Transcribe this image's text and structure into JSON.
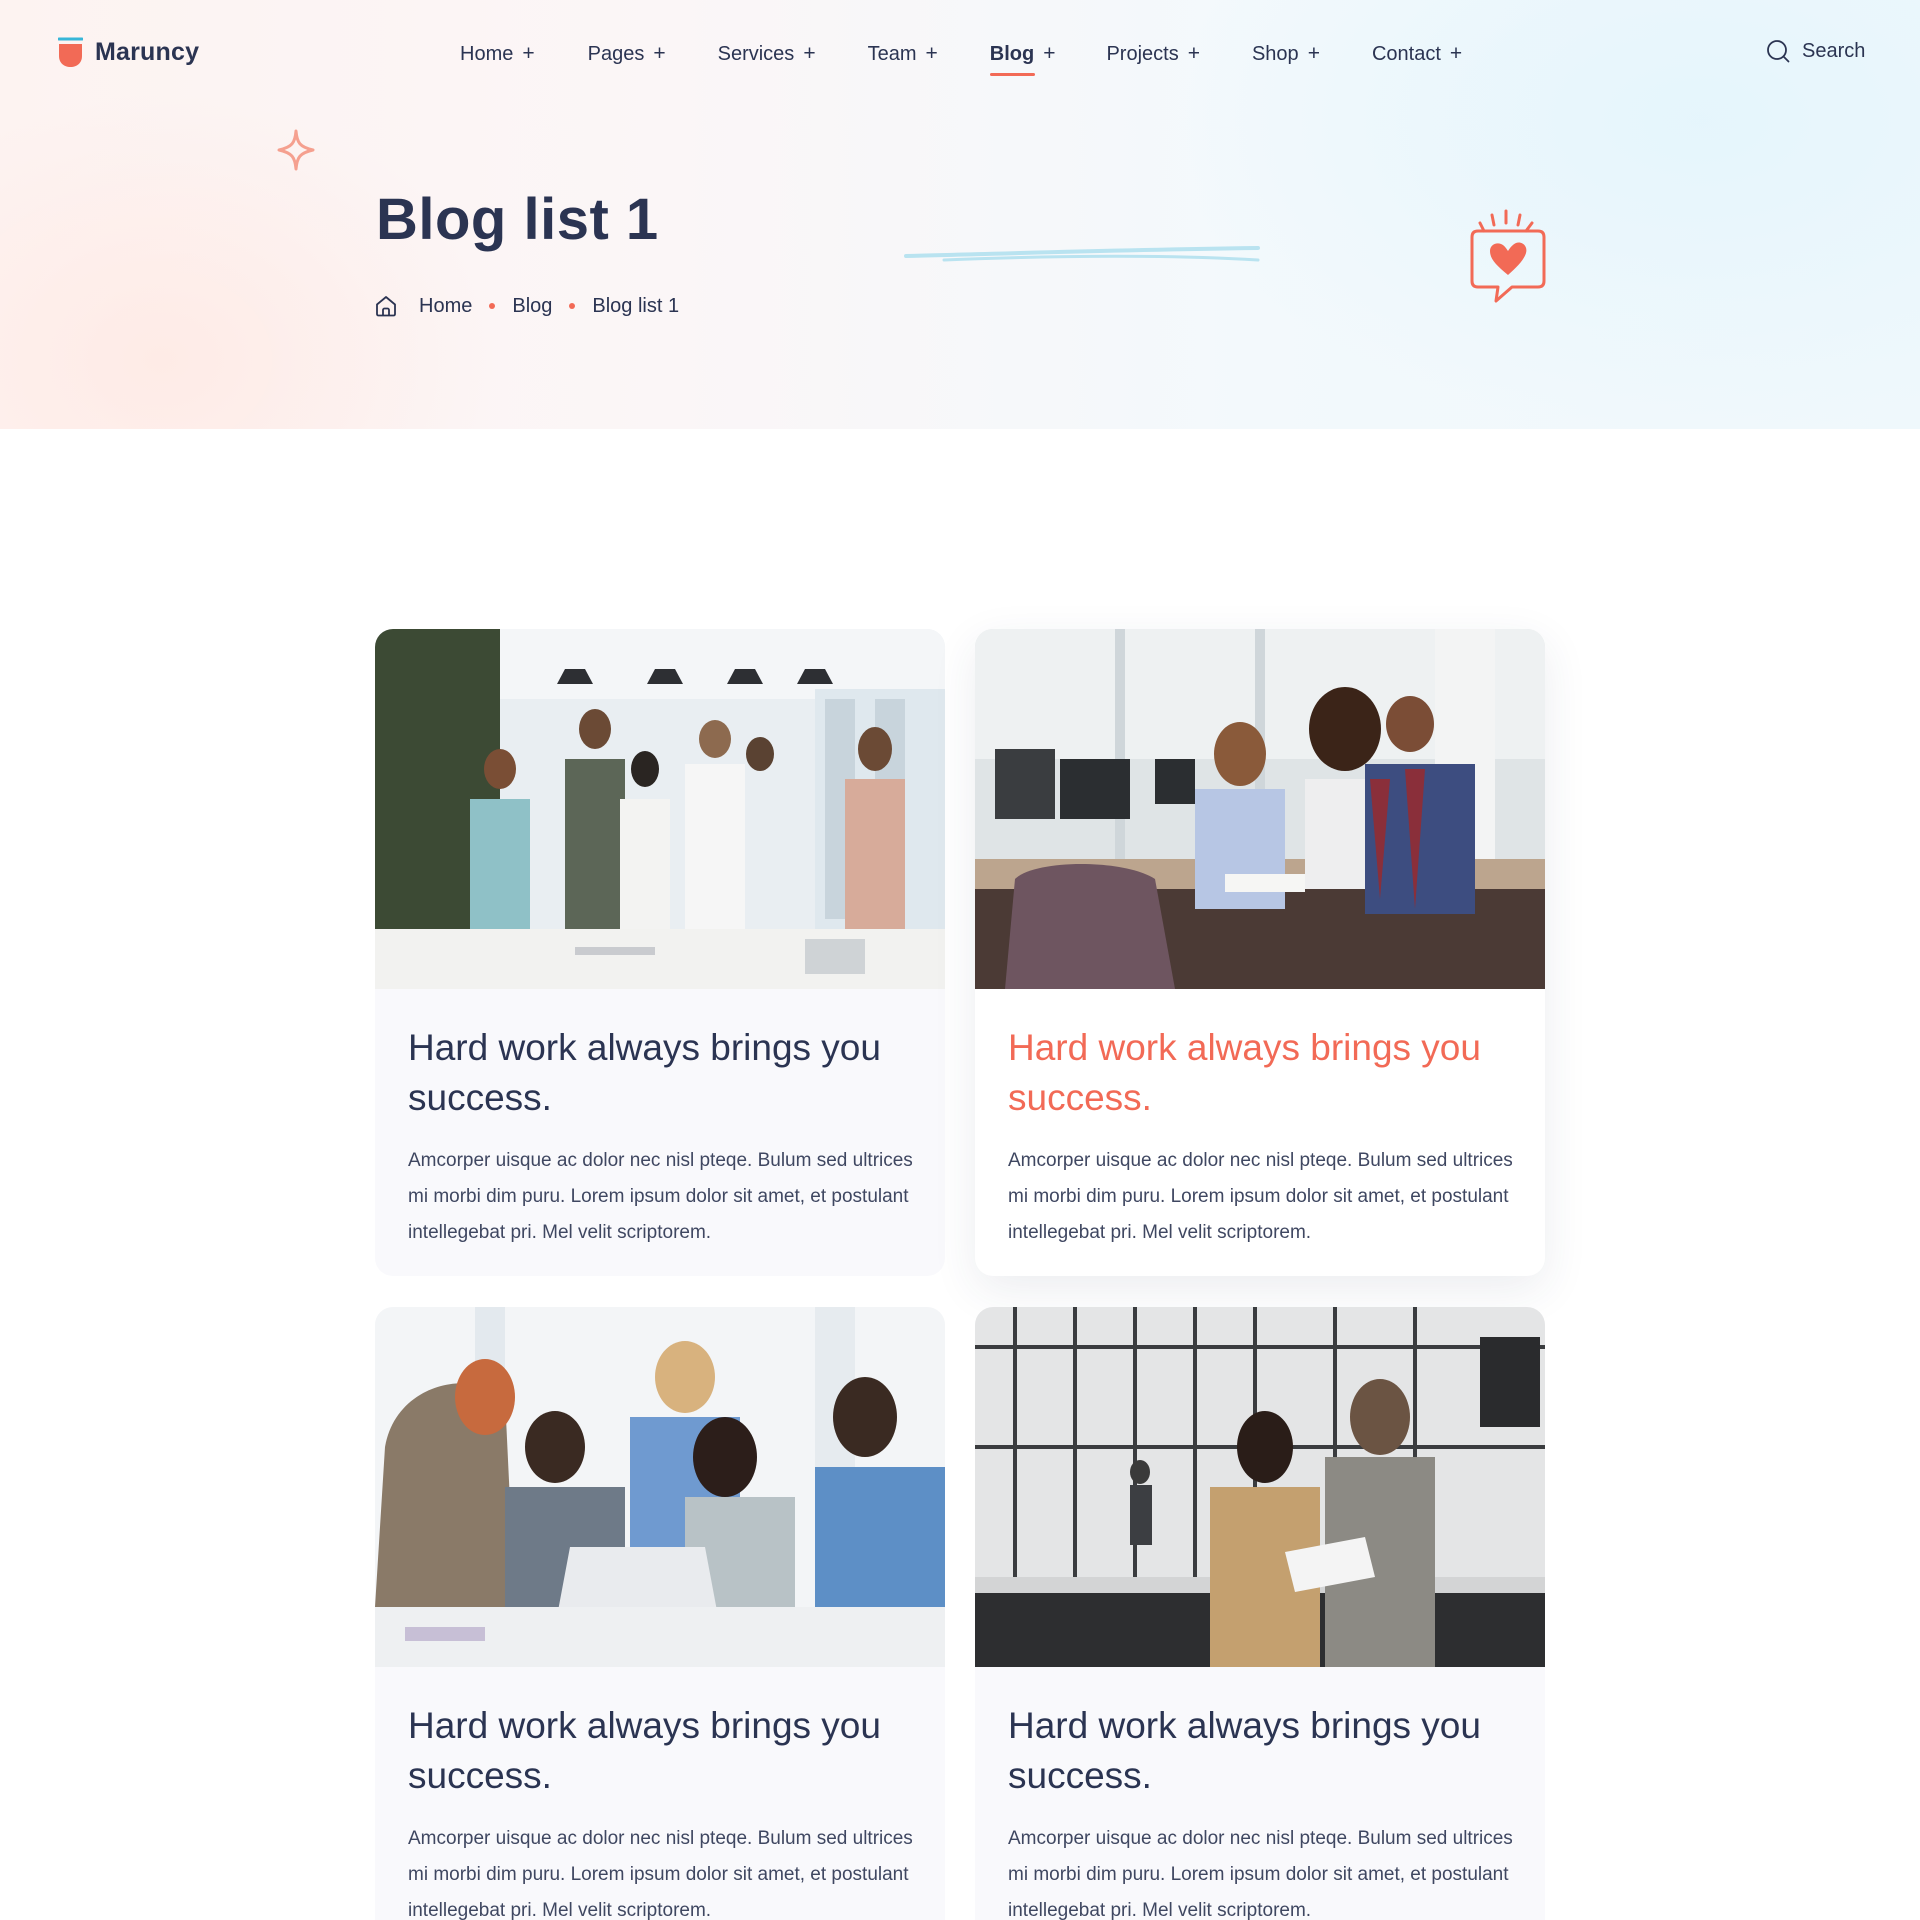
{
  "brand": {
    "name": "Maruncy",
    "accent": "#f26a56",
    "secondary": "#38b6d8",
    "text": "#2b3452"
  },
  "nav": {
    "items": [
      {
        "label": "Home",
        "active": false
      },
      {
        "label": "Pages",
        "active": false
      },
      {
        "label": "Services",
        "active": false
      },
      {
        "label": "Team",
        "active": false
      },
      {
        "label": "Blog",
        "active": true
      },
      {
        "label": "Projects",
        "active": false
      },
      {
        "label": "Shop",
        "active": false
      },
      {
        "label": "Contact",
        "active": false
      }
    ],
    "expand_symbol": "+"
  },
  "search": {
    "label": "Search",
    "icon": "search-icon"
  },
  "hero": {
    "title": "Blog list 1",
    "breadcrumb": [
      "Home",
      "Blog",
      "Blog list 1"
    ],
    "decorations": [
      "sparkle-icon",
      "heart-chat-icon"
    ]
  },
  "posts": [
    {
      "title": "Hard work always brings you success.",
      "excerpt": "Amcorper uisque ac dolor nec nisl pteqe. Bulum sed ultrices mi morbi dim puru. Lorem ipsum dolor sit amet, et postulant intellegebat pri. Mel velit scriptorem.",
      "image": "team-handshake-office-photo",
      "highlighted": false
    },
    {
      "title": "Hard work always brings you success.",
      "excerpt": "Amcorper uisque ac dolor nec nisl pteqe. Bulum sed ultrices mi morbi dim puru. Lorem ipsum dolor sit amet, et postulant intellegebat pri. Mel velit scriptorem.",
      "image": "colleagues-reviewing-document-photo",
      "highlighted": true
    },
    {
      "title": "Hard work always brings you success.",
      "excerpt": "Amcorper uisque ac dolor nec nisl pteqe. Bulum sed ultrices mi morbi dim puru. Lorem ipsum dolor sit amet, et postulant intellegebat pri. Mel velit scriptorem.",
      "image": "team-meeting-laptop-photo",
      "highlighted": false
    },
    {
      "title": "Hard work always brings you success.",
      "excerpt": "Amcorper uisque ac dolor nec nisl pteqe. Bulum sed ultrices mi morbi dim puru. Lorem ipsum dolor sit amet, et postulant intellegebat pri. Mel velit scriptorem.",
      "image": "two-women-reviewing-papers-photo",
      "highlighted": false
    }
  ]
}
